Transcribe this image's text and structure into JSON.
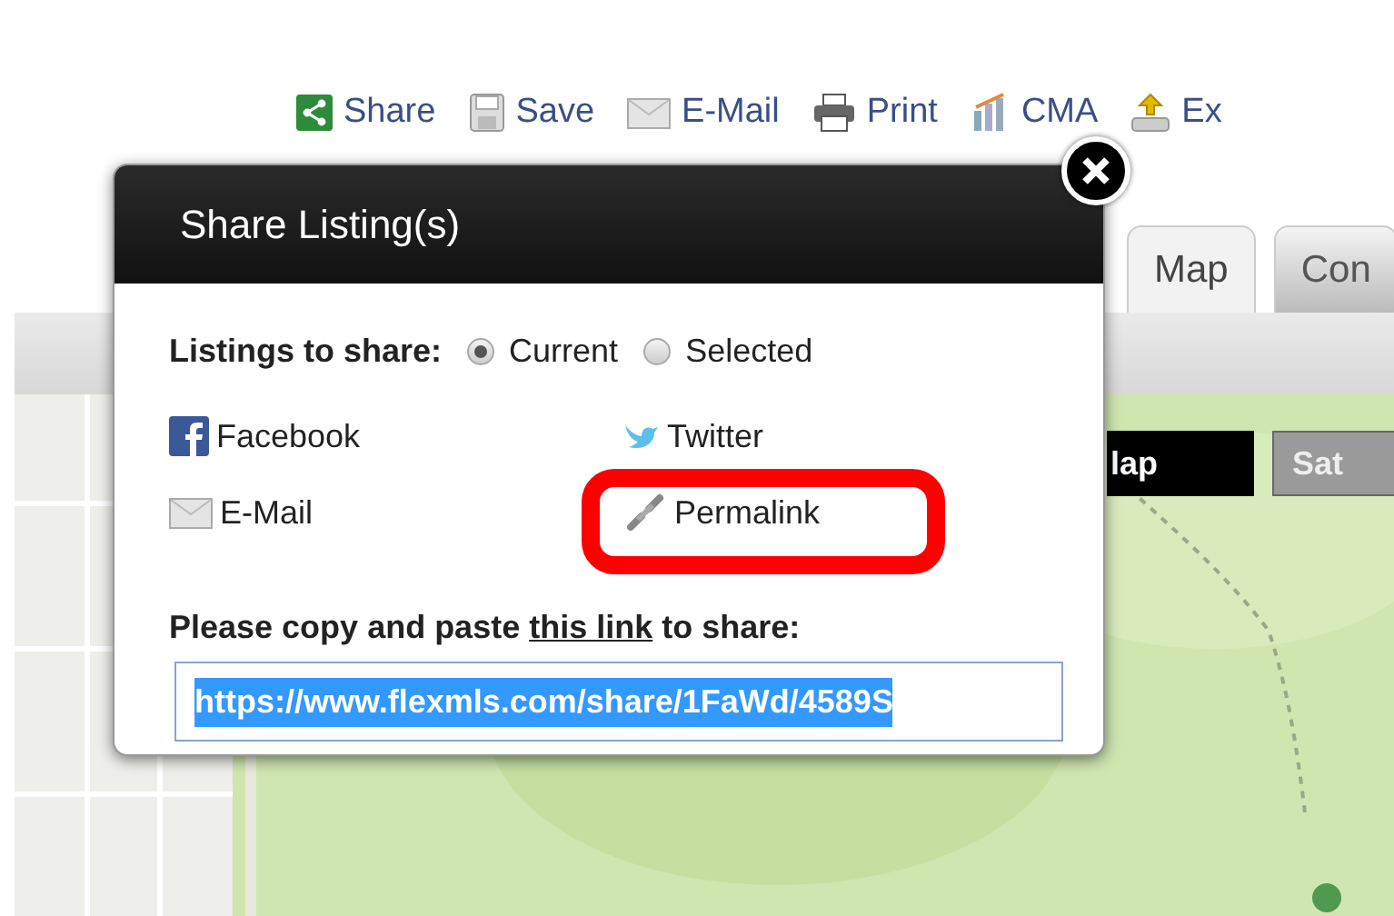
{
  "toolbar": [
    {
      "kind": "share",
      "label": "Share"
    },
    {
      "kind": "save",
      "label": "Save"
    },
    {
      "kind": "email",
      "label": "E-Mail"
    },
    {
      "kind": "print",
      "label": "Print"
    },
    {
      "kind": "cma",
      "label": "CMA"
    },
    {
      "kind": "export",
      "label": "Ex"
    }
  ],
  "tabs": [
    {
      "label": "Map",
      "selected": true
    },
    {
      "label": "Con",
      "selected": false
    }
  ],
  "map": {
    "buttons": [
      {
        "label": "lap",
        "selected": true
      },
      {
        "label": "Sat",
        "selected": false
      }
    ]
  },
  "dialog": {
    "title": "Share Listing(s)",
    "scope_label": "Listings to share:",
    "scope_options": [
      {
        "label": "Current",
        "selected": true
      },
      {
        "label": "Selected",
        "selected": false
      }
    ],
    "share_links": [
      {
        "kind": "facebook",
        "label": "Facebook",
        "highlighted": false
      },
      {
        "kind": "twitter",
        "label": "Twitter",
        "highlighted": false
      },
      {
        "kind": "email",
        "label": "E-Mail",
        "highlighted": false
      },
      {
        "kind": "permalink",
        "label": "Permalink",
        "highlighted": true
      }
    ],
    "copy_prompt": {
      "before": "Please copy and paste ",
      "link": "this link",
      "after": " to share:"
    },
    "link_value": "https://www.flexmls.com/share/1FaWd/4589S"
  }
}
